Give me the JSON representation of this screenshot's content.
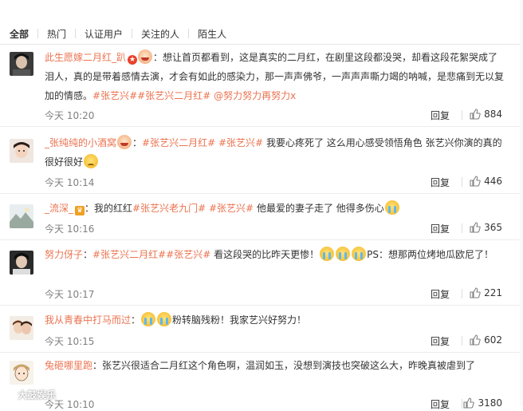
{
  "filters": [
    "全部",
    "热门",
    "认证用户",
    "关注的人",
    "陌生人"
  ],
  "comments": [
    {
      "user": "此生愿嫁二月红_趴",
      "text_parts": [
        "：想让首页都看到，这是真实的二月红，在剧里这段都没哭，却看这段花絮哭成了泪人，真的是带着感情去演，才会有如此的感染力，那一声声佛爷，一声声声嘶力竭的呐喊，是悲痛到无以复加的情感。",
        "#张艺兴#",
        "#张艺兴二月红#",
        "@努力努力再努力x"
      ],
      "time": "今天 10:20",
      "reply": "回复",
      "likes": "884"
    },
    {
      "user": "_张纯纯的小酒窝",
      "text_parts": [
        "#张艺兴二月红#",
        "#张艺兴#",
        "我要心疼死了 这么用心感受领悟角色 张艺兴你演的真的很好很好"
      ],
      "time": "今天 10:14",
      "reply": "回复",
      "likes": "446"
    },
    {
      "user": "_流深_",
      "text_parts": [
        "：我的红红",
        "#张艺兴老九门#",
        "#张艺兴#",
        "他最爱的妻子走了 他得多伤心"
      ],
      "time": "今天 10:16",
      "reply": "回复",
      "likes": "365"
    },
    {
      "user": "努力伢子",
      "text_parts": [
        "：",
        "#张艺兴二月红#",
        "#张艺兴#",
        "看这段哭的比昨天更惨！",
        "PS：想那两位烤地瓜欧尼了！"
      ],
      "time": "今天 10:17",
      "reply": "回复",
      "likes": "221"
    },
    {
      "user": "我从青春中打马而过",
      "text_parts": [
        "：",
        "粉转脑残粉！我家艺兴好努力！"
      ],
      "time": "今天 10:15",
      "reply": "回复",
      "likes": "602"
    },
    {
      "user": "兔砸哪里跑",
      "text_parts": [
        "：张艺兴很适合二月红这个角色啊，温润如玉，没想到演技也突破这么大，昨晚真被虐到了"
      ],
      "time": "今天 10:10",
      "reply": "回复",
      "likes": "3180"
    }
  ],
  "watermark": "大鼓娱乐",
  "colors": {
    "link": "#eb7350",
    "text": "#333333",
    "time": "#808080"
  }
}
